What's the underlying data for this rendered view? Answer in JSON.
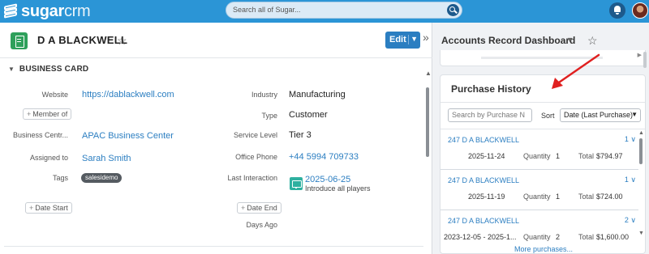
{
  "topbar": {
    "logo_bold": "sugar",
    "logo_light": "crm",
    "search_placeholder": "Search all of Sugar..."
  },
  "record": {
    "title": "D A BLACKWELL",
    "edit_label": "Edit",
    "section_title": "BUSINESS CARD",
    "fields": {
      "website_label": "Website",
      "website_value": "https://dablackwell.com",
      "member_of_label": "Member of",
      "business_center_label": "Business Centr...",
      "business_center_value": "APAC Business Center",
      "assigned_to_label": "Assigned to",
      "assigned_to_value": "Sarah Smith",
      "tags_label": "Tags",
      "tag_value": "salesidemo",
      "date_start_label": "Date Start",
      "industry_label": "Industry",
      "industry_value": "Manufacturing",
      "type_label": "Type",
      "type_value": "Customer",
      "service_level_label": "Service Level",
      "service_level_value": "Tier 3",
      "office_phone_label": "Office Phone",
      "office_phone_value": "+44 5994 709733",
      "last_interaction_label": "Last Interaction",
      "last_interaction_date": "2025-06-25",
      "last_interaction_subject": "Introduce all players",
      "date_end_label": "Date End",
      "days_ago_label": "Days Ago"
    }
  },
  "dashboard": {
    "title": "Accounts Record Dashboard",
    "purchase_history": {
      "title": "Purchase History",
      "search_placeholder": "Search by Purchase N",
      "sort_label": "Sort",
      "sort_value": "Date (Last Purchase)",
      "quantity_label": "Quantity",
      "total_label": "Total",
      "rows": [
        {
          "name": "247 D A BLACKWELL",
          "count": "1",
          "date": "2025-11-24",
          "quantity": "1",
          "total": "$794.97"
        },
        {
          "name": "247 D A BLACKWELL",
          "count": "1",
          "date": "2025-11-19",
          "quantity": "1",
          "total": "$724.00"
        },
        {
          "name": "247 D A BLACKWELL",
          "count": "2",
          "date": "2023-12-05 - 2025-1...",
          "quantity": "2",
          "total": "$1,600.00"
        }
      ],
      "more_label": "More purchases..."
    }
  },
  "colors": {
    "brand": "#2b95d6",
    "link": "#2b7ec1",
    "record_icon": "#2fa05b",
    "annotation_arrow": "#e02020"
  }
}
